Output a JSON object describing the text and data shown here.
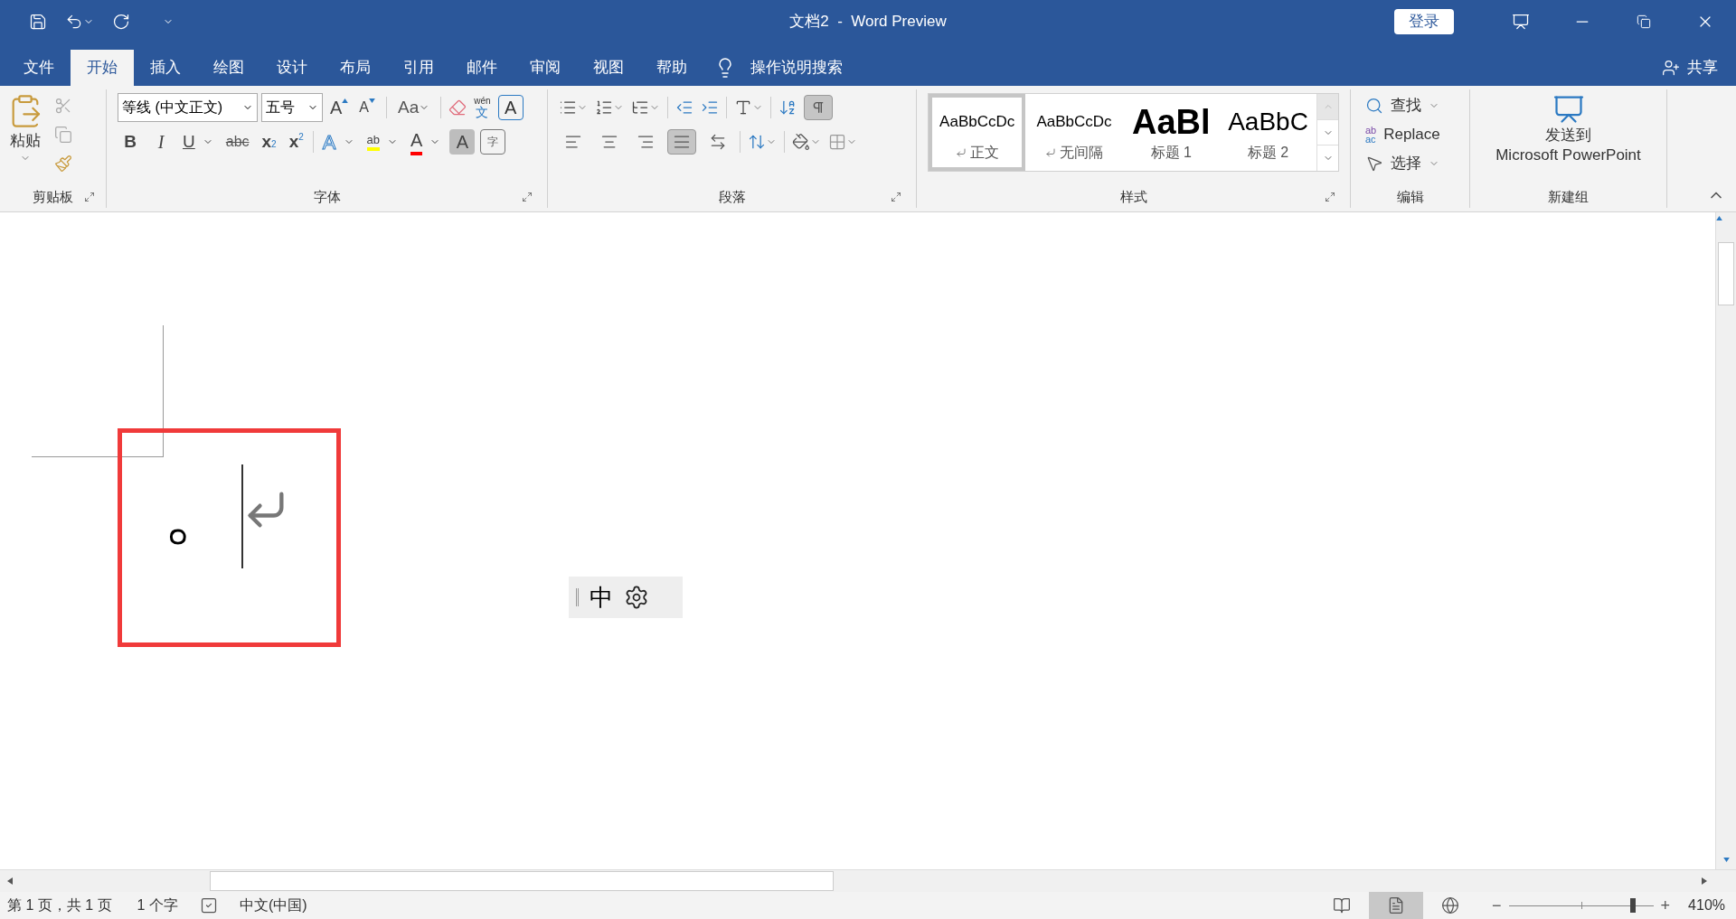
{
  "window": {
    "title": "文档2  -  Word Preview",
    "sign_in": "登录"
  },
  "tabs": [
    {
      "label": "文件",
      "selected": false
    },
    {
      "label": "开始",
      "selected": true
    },
    {
      "label": "插入",
      "selected": false
    },
    {
      "label": "绘图",
      "selected": false
    },
    {
      "label": "设计",
      "selected": false
    },
    {
      "label": "布局",
      "selected": false
    },
    {
      "label": "引用",
      "selected": false
    },
    {
      "label": "邮件",
      "selected": false
    },
    {
      "label": "审阅",
      "selected": false
    },
    {
      "label": "视图",
      "selected": false
    },
    {
      "label": "帮助",
      "selected": false
    }
  ],
  "tell_me": "操作说明搜索",
  "share": "共享",
  "clipboard": {
    "paste": "粘贴",
    "label": "剪贴板"
  },
  "font": {
    "name": "等线 (中文正文)",
    "size": "五号",
    "case": "Aa",
    "phonetic": "wén",
    "phonetic_char": "文",
    "border_char": "A",
    "grow": "A",
    "shrink": "A",
    "styles": [
      "B",
      "I",
      "U",
      "abc"
    ],
    "sub": "x",
    "sub_mark": "2",
    "sup": "x",
    "sup_mark": "2",
    "effects": "A",
    "highlight": "ab",
    "color_letter": "A",
    "shading": "A",
    "enclose": "字",
    "label": "字体"
  },
  "paragraph": {
    "label": "段落",
    "show_marks": true,
    "align": [
      {
        "kind": "left",
        "selected": false
      },
      {
        "kind": "center",
        "selected": false
      },
      {
        "kind": "right",
        "selected": false
      },
      {
        "kind": "justify",
        "selected": true
      },
      {
        "kind": "distributed",
        "selected": false
      }
    ]
  },
  "styles": {
    "label": "样式",
    "items": [
      {
        "preview": "AaBbCcDc",
        "name": "正文",
        "mark": true,
        "kind": "normal",
        "selected": true
      },
      {
        "preview": "AaBbCcDc",
        "name": "无间隔",
        "mark": true,
        "kind": "normal",
        "selected": false
      },
      {
        "preview": "AaBl",
        "name": "标题 1",
        "mark": false,
        "kind": "heading1",
        "selected": false
      },
      {
        "preview": "AaBbC",
        "name": "标题 2",
        "mark": false,
        "kind": "heading2",
        "selected": false
      }
    ]
  },
  "editing": {
    "label": "编辑",
    "find": "查找",
    "replace": "Replace",
    "replace_icon_top": "ab",
    "replace_icon_bottom": "ac",
    "select": "选择"
  },
  "new_group": {
    "label": "新建组",
    "send_line1": "发送到",
    "send_line2": "Microsoft PowerPoint"
  },
  "document": {
    "text": "。"
  },
  "ime": {
    "mode": "中"
  },
  "status_bar": {
    "page": "第 1 页，共 1 页",
    "words": "1 个字",
    "language": "中文(中国)",
    "views": [
      {
        "kind": "read",
        "selected": false
      },
      {
        "kind": "print",
        "selected": true
      },
      {
        "kind": "web",
        "selected": false
      }
    ],
    "zoom_out": "−",
    "zoom_in": "+",
    "zoom": {
      "level": 0.86
    },
    "zoom_text": "410%"
  }
}
